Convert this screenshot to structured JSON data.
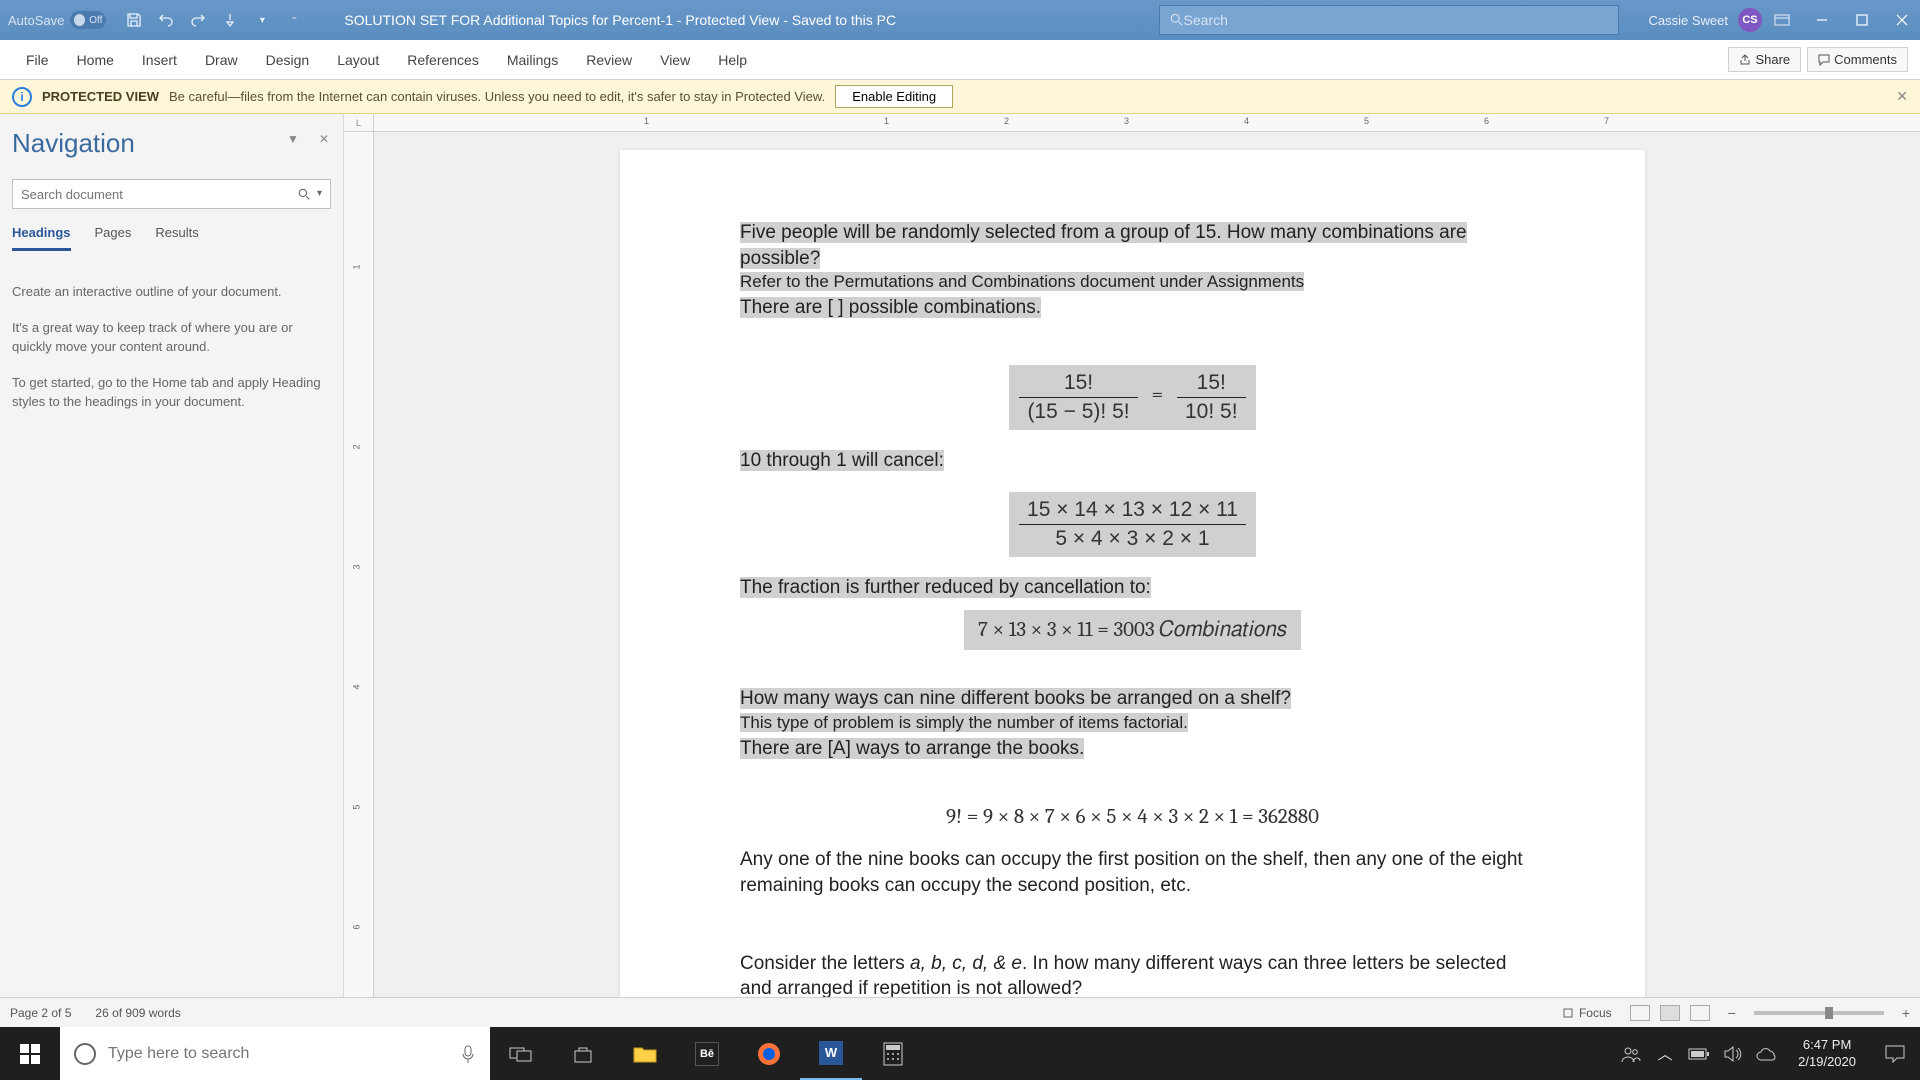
{
  "titlebar": {
    "autosave_label": "AutoSave",
    "autosave_state": "Off",
    "doc_title": "SOLUTION SET FOR Additional Topics for Percent-1  -  Protected View  -  Saved to this PC",
    "search_placeholder": "Search",
    "user_name": "Cassie Sweet",
    "user_initials": "CS"
  },
  "ribbon": {
    "tabs": [
      "File",
      "Home",
      "Insert",
      "Draw",
      "Design",
      "Layout",
      "References",
      "Mailings",
      "Review",
      "View",
      "Help"
    ],
    "share": "Share",
    "comments": "Comments"
  },
  "protected": {
    "label": "PROTECTED VIEW",
    "msg": "Be careful—files from the Internet can contain viruses. Unless you need to edit, it's safer to stay in Protected View.",
    "enable": "Enable Editing"
  },
  "nav": {
    "title": "Navigation",
    "search_placeholder": "Search document",
    "tabs": [
      "Headings",
      "Pages",
      "Results"
    ],
    "info": [
      "Create an interactive outline of your document.",
      "It's a great way to keep track of where you are or quickly move your content around.",
      "To get started, go to the Home tab and apply Heading styles to the headings in your document."
    ]
  },
  "ruler_h": [
    "1",
    "1",
    "2",
    "3",
    "4",
    "5",
    "6",
    "7"
  ],
  "ruler_v": [
    "1",
    "2",
    "3",
    "4",
    "5",
    "6"
  ],
  "doc": {
    "p1": "Five people will be randomly selected from a group of 15.  How many combinations are possible?",
    "p2": "Refer to the Permutations and Combinations document under Assignments",
    "p3": "There are [  ] possible combinations.",
    "eq1_lhs_num": "15!",
    "eq1_lhs_den": "(15 − 5)! 5!",
    "eq1_eq": "=",
    "eq1_rhs_num": "15!",
    "eq1_rhs_den": "10! 5!",
    "p4": "10 through 1 will cancel:",
    "eq2_num": "15  × 14 × 13 × 12 × 11",
    "eq2_den": "5  × 4 × 3 × 2 × 1",
    "p5": "The fraction is further reduced by cancellation to:",
    "eq3": "7  × 13  × 3  × 11  =   3003 𝐶𝑜𝑚𝑏𝑖𝑛𝑎𝑡𝑖𝑜𝑛𝑠",
    "p6": "How many ways can nine different books be arranged on a shelf?",
    "p7": "This type of problem is simply the number of items factorial.",
    "p8": "There are [A] ways to arrange the books.",
    "eq4": "9! = 9 × 8 × 7 × 6 × 5 × 4 × 3 × 2 × 1 = 362880",
    "p9": "Any one of the nine books can occupy the first position on the shelf, then any one of the eight remaining books can occupy the second position, etc.",
    "p10a": "Consider the letters ",
    "p10b": "a, b, c, d, & e",
    "p10c": ".  In how many different ways can three letters be selected and arranged if repetition is not allowed?"
  },
  "status": {
    "page": "Page 2 of 5",
    "words": "26 of 909 words",
    "focus": "Focus"
  },
  "taskbar": {
    "search_placeholder": "Type here to search",
    "time": "6:47 PM",
    "date": "2/19/2020"
  }
}
